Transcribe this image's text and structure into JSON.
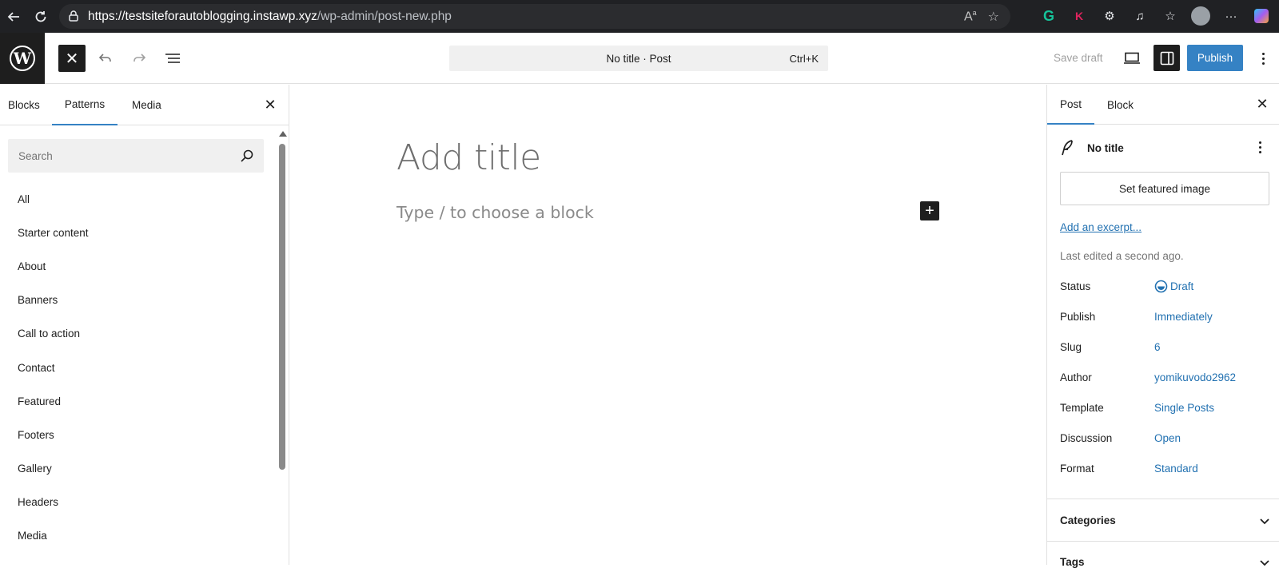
{
  "browser": {
    "url_host": "https://testsiteforautoblogging.instawp.xyz",
    "url_path": "/wp-admin/post-new.php",
    "ext_k": "K"
  },
  "header": {
    "command_title": "No title · Post",
    "command_shortcut": "Ctrl+K",
    "save_draft": "Save draft",
    "publish": "Publish"
  },
  "inserter": {
    "tabs": [
      "Blocks",
      "Patterns",
      "Media"
    ],
    "active_tab": "Patterns",
    "search_placeholder": "Search",
    "categories": [
      "All",
      "Starter content",
      "About",
      "Banners",
      "Call to action",
      "Contact",
      "Featured",
      "Footers",
      "Gallery",
      "Headers",
      "Media"
    ]
  },
  "editor": {
    "title_placeholder": "Add title",
    "block_placeholder": "Type / to choose a block"
  },
  "sidebar": {
    "tabs": [
      "Post",
      "Block"
    ],
    "active_tab": "Post",
    "post_title": "No title",
    "featured_image": "Set featured image",
    "excerpt_link": "Add an excerpt...",
    "last_edited": "Last edited a second ago.",
    "meta": [
      {
        "label": "Status",
        "value": "Draft"
      },
      {
        "label": "Publish",
        "value": "Immediately"
      },
      {
        "label": "Slug",
        "value": "6"
      },
      {
        "label": "Author",
        "value": "yomikuvodo2962"
      },
      {
        "label": "Template",
        "value": "Single Posts"
      },
      {
        "label": "Discussion",
        "value": "Open"
      },
      {
        "label": "Format",
        "value": "Standard"
      }
    ],
    "panels": [
      "Categories",
      "Tags"
    ]
  },
  "colors": {
    "accent": "#3582c4",
    "link": "#2271b1",
    "dark": "#1e1e1e"
  }
}
